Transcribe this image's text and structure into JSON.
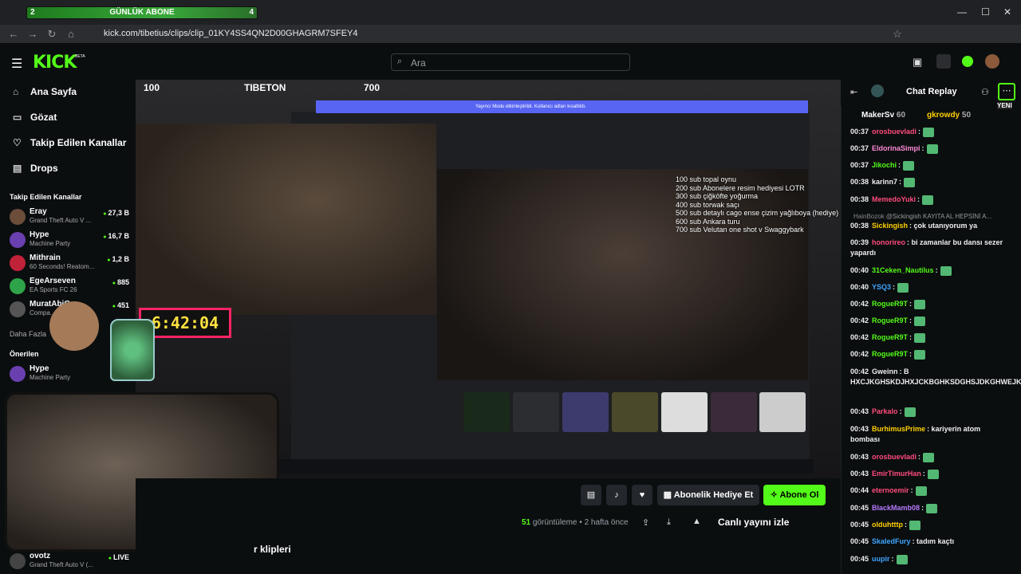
{
  "browser": {
    "url": "kick.com/tibetius/clips/clip_01KY4SS4QN2D00GHAGRM7SFEY4"
  },
  "subgoal": {
    "left": "2",
    "label": "GÜNLÜK ABONE",
    "right": "4"
  },
  "header": {
    "logo": "KICK",
    "logo_beta": "BETA",
    "search_placeholder": "Ara"
  },
  "sidebar": {
    "nav": [
      "Ana Sayfa",
      "Gözat",
      "Takip Edilen Kanallar",
      "Drops"
    ],
    "followed_title": "Takip Edilen Kanallar",
    "channels": [
      {
        "name": "Eray",
        "game": "Grand Theft Auto V ...",
        "viewers": "27,3 B"
      },
      {
        "name": "Hype",
        "game": "Machine Party",
        "viewers": "16,7 B"
      },
      {
        "name": "Mithrain",
        "game": "60 Seconds! Reatom...",
        "viewers": "1,2 B"
      },
      {
        "name": "EgeArseven",
        "game": "EA Sports FC 26",
        "viewers": "885"
      },
      {
        "name": "MuratAbiG",
        "game": "Compa...",
        "viewers": "451"
      }
    ],
    "more": "Daha Fazla",
    "recommended_title": "Önerilen",
    "recommended": [
      {
        "name": "Hype",
        "game": "Machine Party",
        "viewers": "1"
      },
      {
        "name": "ovotz",
        "game": "Grand Theft Auto V (...",
        "viewers": "LIVE"
      }
    ]
  },
  "video": {
    "hud_left": "100",
    "hud_name": "TIBETON",
    "hud_right": "700",
    "timer": "6:42:04",
    "sub_goals": [
      "100 sub topal oynu",
      "200 sub Abonelere resim hediyesi LOTR",
      "300 sub çiğköfte yoğurma",
      "400 sub torwak saçı",
      "500 sub detaylı cago ense çizim yağlıboya (hediye)",
      "600 sub Ankara turu",
      "700 sub Velutan one shot v Swaggybark"
    ],
    "discord_banner": "Yayıncı Modu etkinleştirildi. Kullanıcı adları kısaltıldı."
  },
  "controls": {
    "gift_label": "Abonelik Hediye Et",
    "subscribe_label": "Abone Ol",
    "views_count": "51",
    "views_label": "görüntüleme",
    "time_ago": "2 hafta önce",
    "watch_live": "Canlı yayını izle",
    "clips_header": "r klipleri"
  },
  "chat": {
    "title": "Chat Replay",
    "new_badge": "YENI",
    "top_users": [
      {
        "name": "MakerSv",
        "count": "60"
      },
      {
        "name": "gkrowdy",
        "count": "50"
      }
    ],
    "messages": [
      {
        "ts": "00:37",
        "user": "orosbuevladi",
        "color": "#ff4b7d",
        "text": ":"
      },
      {
        "ts": "00:37",
        "user": "EldorinaSimpi",
        "color": "#ff8ad9",
        "text": ":"
      },
      {
        "ts": "00:37",
        "user": "Jikochi",
        "color": "#53fc18",
        "text": ":"
      },
      {
        "ts": "00:38",
        "user": "karinn7",
        "color": "#efeff1",
        "text": ":"
      },
      {
        "ts": "00:38",
        "user": "MemedoYuki",
        "color": "#ff4b7d",
        "text": ":"
      },
      {
        "ts": "",
        "user": "HainBozok",
        "color": "#888",
        "text": "@Sickingish KAYITA AL HEPSİNİ A..."
      },
      {
        "ts": "00:38",
        "user": "Sickingish",
        "color": "#ffd000",
        "text": ": çok utanıyorum ya"
      },
      {
        "ts": "00:39",
        "user": "honorireo",
        "color": "#ff4b7d",
        "text": ": bi zamanlar bu dansı sezer yapardı"
      },
      {
        "ts": "00:40",
        "user": "31Ceken_Nautilus",
        "color": "#53fc18",
        "text": ":"
      },
      {
        "ts": "00:40",
        "user": "YSQ3",
        "color": "#3ea6ff",
        "text": ":"
      },
      {
        "ts": "00:42",
        "user": "RogueR9T",
        "color": "#53fc18",
        "text": ":"
      },
      {
        "ts": "00:42",
        "user": "RogueR9T",
        "color": "#53fc18",
        "text": ":"
      },
      {
        "ts": "00:42",
        "user": "RogueR9T",
        "color": "#53fc18",
        "text": ":"
      },
      {
        "ts": "00:42",
        "user": "RogueR9T",
        "color": "#53fc18",
        "text": ":"
      },
      {
        "ts": "00:42",
        "user": "Gweinn",
        "color": "#efeff1",
        "text": ": B HXCJKGHSKDJHXJCKBGHKSDGHSJDKGHWEJKTHWJEKTW"
      },
      {
        "ts": "00:43",
        "user": "Parkalo",
        "color": "#ff4b7d",
        "text": ":"
      },
      {
        "ts": "00:43",
        "user": "BurhimusPrime",
        "color": "#ffd000",
        "text": ": kariyerin atom bombası"
      },
      {
        "ts": "00:43",
        "user": "orosbuevladi",
        "color": "#ff4b7d",
        "text": ":"
      },
      {
        "ts": "00:43",
        "user": "EmirTimurHan",
        "color": "#ff4b7d",
        "text": ":"
      },
      {
        "ts": "00:44",
        "user": "eternoemir",
        "color": "#ff4b7d",
        "text": ":"
      },
      {
        "ts": "00:45",
        "user": "BlackMamb08",
        "color": "#b57bff",
        "text": ":"
      },
      {
        "ts": "00:45",
        "user": "olduhtttp",
        "color": "#ffd000",
        "text": ":"
      },
      {
        "ts": "00:45",
        "user": "SkaledFury",
        "color": "#3ea6ff",
        "text": ": tadım kaçtı"
      },
      {
        "ts": "00:45",
        "user": "uupir",
        "color": "#3ea6ff",
        "text": ":"
      }
    ]
  }
}
